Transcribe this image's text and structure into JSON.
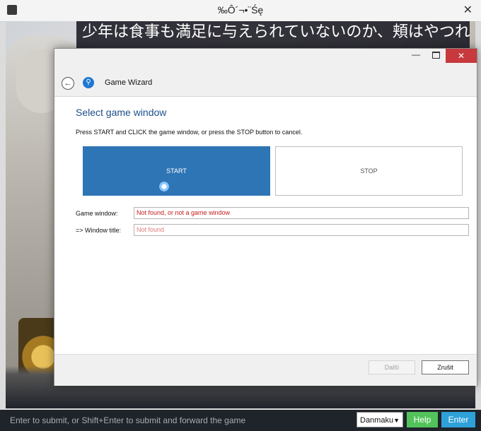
{
  "game_window": {
    "title": "‰Ô´¬•¨Śę",
    "subtitle": "少年は食事も満足に与えられていないのか、頬はやつれ、髪も乱れるままになっている"
  },
  "wizard": {
    "nav_title": "Game Wizard",
    "heading": "Select game window",
    "instruction": "Press START and  CLICK the game window, or press the STOP button to cancel.",
    "start_label": "START",
    "stop_label": "STOP",
    "fields": {
      "game_window_label": "Game window:",
      "game_window_value": "Not found, or not a game window",
      "window_title_label": "=> Window title:",
      "window_title_value": "Not found"
    },
    "buttons": {
      "next": "Další",
      "cancel": "Zrušit"
    }
  },
  "bottom_bar": {
    "input_placeholder": "Enter to submit, or Shift+Enter to submit and forward the game",
    "mode_select": "Danmaku",
    "help": "Help",
    "enter": "Enter"
  },
  "colors": {
    "accent": "#2e75b6",
    "heading": "#1c4f8c",
    "error": "#c41c1c",
    "close": "#c7393c",
    "help": "#52c35a",
    "enter": "#2ea1d9"
  }
}
